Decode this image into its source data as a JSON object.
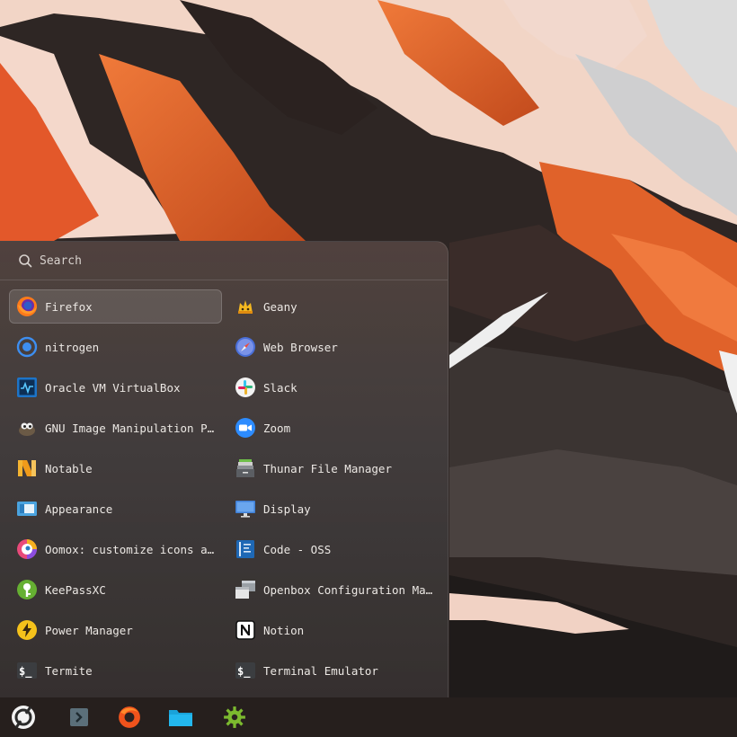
{
  "search": {
    "placeholder": "Search",
    "icon": "search-icon"
  },
  "apps": [
    {
      "label": "Firefox",
      "icon": "firefox-icon",
      "active": true
    },
    {
      "label": "Geany",
      "icon": "geany-icon"
    },
    {
      "label": "nitrogen",
      "icon": "nitrogen-icon"
    },
    {
      "label": "Web Browser",
      "icon": "web-browser-icon"
    },
    {
      "label": "Oracle VM VirtualBox",
      "icon": "virtualbox-icon"
    },
    {
      "label": "Slack",
      "icon": "slack-icon"
    },
    {
      "label": "GNU Image Manipulation Pr…",
      "icon": "gimp-icon"
    },
    {
      "label": "Zoom",
      "icon": "zoom-icon"
    },
    {
      "label": "Notable",
      "icon": "notable-icon"
    },
    {
      "label": "Thunar File Manager",
      "icon": "thunar-icon"
    },
    {
      "label": "Appearance",
      "icon": "appearance-icon"
    },
    {
      "label": "Display",
      "icon": "display-icon"
    },
    {
      "label": "Oomox: customize icons an…",
      "icon": "oomox-icon"
    },
    {
      "label": "Code - OSS",
      "icon": "code-oss-icon"
    },
    {
      "label": "KeePassXC",
      "icon": "keepassxc-icon"
    },
    {
      "label": "Openbox Configuration Man…",
      "icon": "openbox-config-icon"
    },
    {
      "label": "Power Manager",
      "icon": "power-manager-icon"
    },
    {
      "label": "Notion",
      "icon": "notion-icon"
    },
    {
      "label": "Termite",
      "icon": "termite-icon"
    },
    {
      "label": "Terminal Emulator",
      "icon": "terminal-emulator-icon"
    }
  ],
  "taskbar": [
    {
      "name": "launcher-icon"
    },
    {
      "name": "terminal-icon"
    },
    {
      "name": "firefox-icon"
    },
    {
      "name": "files-icon"
    },
    {
      "name": "settings-icon"
    }
  ],
  "colors": {
    "accent_orange": "#f06422",
    "wallpaper_snow": "#f1d2c4",
    "panel": "#4a4140"
  }
}
